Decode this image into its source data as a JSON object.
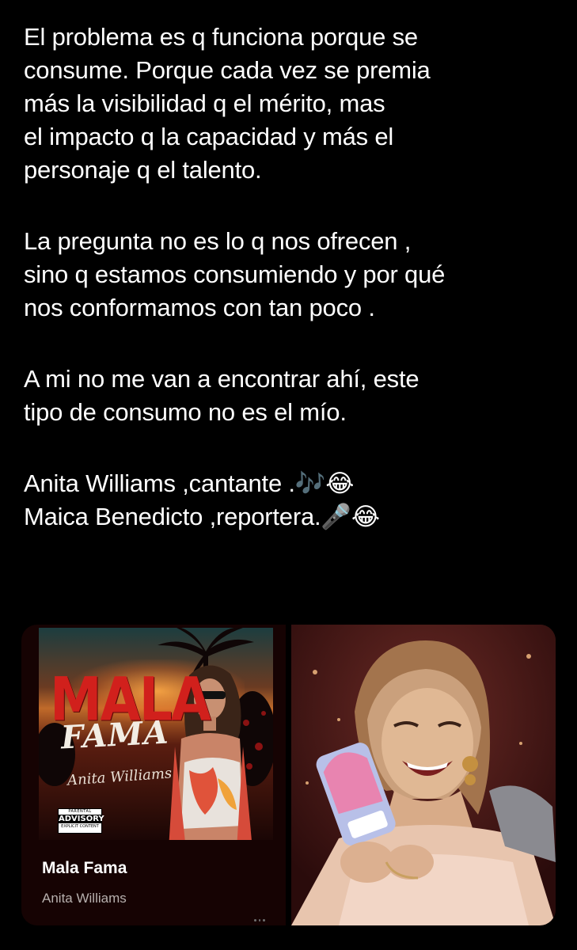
{
  "tweet": {
    "paragraphs": [
      [
        "El problema es q funciona porque se",
        "consume. Porque cada vez se premia",
        "más la visibilidad q el mérito, mas",
        "el impacto q la capacidad y más el",
        "personaje q el talento."
      ],
      [
        "La pregunta no es lo q nos ofrecen ,",
        "sino q estamos consumiendo y por qué",
        "nos conformamos con tan poco ."
      ],
      [
        "A mi no me van a encontrar ahí, este",
        "tipo de consumo no es el mío."
      ]
    ],
    "signature": {
      "line1_text": "Anita Williams ,cantante .",
      "line1_emoji": "🎶😂",
      "line2_text": "Maica Benedicto ,reportera.",
      "line2_emoji": "🎤😂"
    }
  },
  "media": {
    "music_card": {
      "cover": {
        "title_top": "MALA",
        "title_bottom": "FAMA",
        "artist_script": "Anita Williams",
        "advisory": {
          "top": "PARENTAL",
          "middle": "ADVISORY",
          "bottom": "EXPLICIT CONTENT"
        }
      },
      "track_title": "Mala Fama",
      "track_artist": "Anita Williams"
    },
    "photo": {
      "icon": "person-photo-icon"
    }
  },
  "colors": {
    "background": "#000000",
    "text": "#ffffff",
    "secondary_text": "#b7b0ae",
    "cover_red": "#d1201c"
  }
}
